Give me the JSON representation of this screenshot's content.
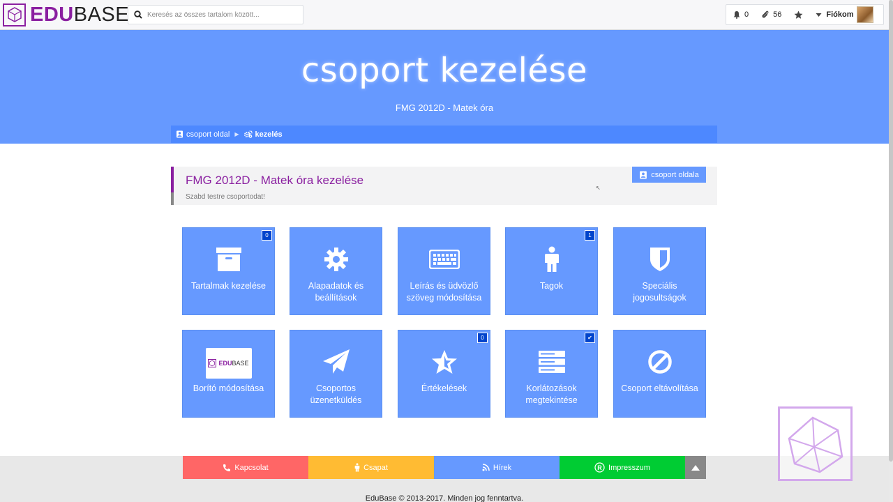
{
  "brand": {
    "part1": "EDU",
    "part2": "BASE",
    "color": "#8a1fa0"
  },
  "search": {
    "placeholder": "Keresés az összes tartalom között..."
  },
  "nav": {
    "notifications": "0",
    "attachments": "56",
    "account": "Fiókom"
  },
  "hero": {
    "title": "csoport kezelése",
    "subtitle": "FMG 2012D - Matek óra",
    "color": "#6699ff"
  },
  "breadcrumb": {
    "items": [
      "csoport oldal",
      "kezelés"
    ]
  },
  "panel": {
    "title": "FMG 2012D - Matek óra kezelése",
    "subtitle": "Szabd testre csoportodat!",
    "button": "csoport oldala"
  },
  "tiles": [
    {
      "label": "Tartalmak kezelése",
      "icon": "archive-icon",
      "badge": "0"
    },
    {
      "label": "Alapadatok és beállítások",
      "icon": "gear-icon"
    },
    {
      "label": "Leírás és üdvözlő szöveg módosítása",
      "icon": "keyboard-icon"
    },
    {
      "label": "Tagok",
      "icon": "person-icon",
      "badge": "1"
    },
    {
      "label": "Speciális jogosultságok",
      "icon": "shield-icon"
    },
    {
      "label": "Borító módosítása",
      "icon": "cover-image-icon",
      "cover_text_1": "EDU",
      "cover_text_2": "BASE"
    },
    {
      "label": "Csoportos üzenetküldés",
      "icon": "paper-plane-icon"
    },
    {
      "label": "Értékelések",
      "icon": "star-half-icon",
      "badge": "0"
    },
    {
      "label": "Korlátozások megtekintése",
      "icon": "server-icon",
      "badge": "✔"
    },
    {
      "label": "Csoport eltávolítása",
      "icon": "ban-icon"
    }
  ],
  "footer": {
    "links": [
      {
        "label": "Kapcsolat",
        "icon": "phone-icon",
        "color": "#ff6666"
      },
      {
        "label": "Csapat",
        "icon": "person-icon",
        "color": "#ffbb33"
      },
      {
        "label": "Hírek",
        "icon": "rss-icon",
        "color": "#6699ff"
      },
      {
        "label": "Impresszum",
        "icon": "registered-icon",
        "color": "#00cc33"
      }
    ],
    "copyright": "EduBase © 2013-2017. Minden jog fenntartva."
  }
}
